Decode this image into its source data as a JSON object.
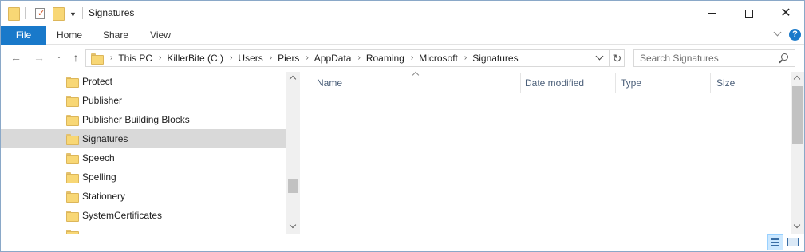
{
  "window": {
    "title": "Signatures",
    "controls": {
      "minimize": "",
      "maximize": "",
      "close": "✕"
    }
  },
  "ribbon": {
    "tabs": [
      {
        "label": "File"
      },
      {
        "label": "Home"
      },
      {
        "label": "Share"
      },
      {
        "label": "View"
      }
    ],
    "accent": "#1979ca",
    "help": "?"
  },
  "navigation": {
    "back": "←",
    "forward": "→",
    "recent": "⌄",
    "up": "↑",
    "breadcrumb": [
      "This PC",
      "KillerBite (C:)",
      "Users",
      "Piers",
      "AppData",
      "Roaming",
      "Microsoft",
      "Signatures"
    ],
    "breadcrumb_separator": "›",
    "refresh": "↻",
    "search_placeholder": "Search Signatures"
  },
  "tree": {
    "items": [
      {
        "label": "Protect",
        "selected": false
      },
      {
        "label": "Publisher",
        "selected": false
      },
      {
        "label": "Publisher Building Blocks",
        "selected": false
      },
      {
        "label": "Signatures",
        "selected": true
      },
      {
        "label": "Speech",
        "selected": false
      },
      {
        "label": "Spelling",
        "selected": false
      },
      {
        "label": "Stationery",
        "selected": false
      },
      {
        "label": "SystemCertificates",
        "selected": false
      }
    ],
    "selected_color": "#d9d9d9"
  },
  "file_list": {
    "columns": [
      {
        "label": "Name"
      },
      {
        "label": "Date modified"
      },
      {
        "label": "Type"
      },
      {
        "label": "Size"
      }
    ],
    "sorted_by": "Name",
    "rows": []
  },
  "statusbar": {
    "views": [
      "details-view-icon",
      "large-icons-view-icon"
    ],
    "active_view": "details-view-icon"
  }
}
